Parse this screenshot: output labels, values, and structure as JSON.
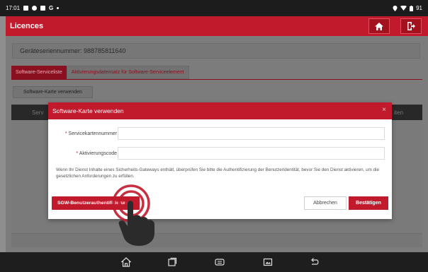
{
  "status_bar": {
    "time": "17:01",
    "battery": "91"
  },
  "app": {
    "title": "Licences",
    "accent_color": "#c01a2c"
  },
  "page": {
    "serial_label": "Geräteseriennummer: 988785811640",
    "tabs": [
      {
        "label": "Software-Serviceliste",
        "active": true
      },
      {
        "label": "Aktivierungsdatensatz für Software-Serviceelement",
        "active": false
      }
    ],
    "use_card_button": "Software-Karte verwenden",
    "table_headers": [
      "Serv",
      "iten"
    ]
  },
  "modal": {
    "title": "Software-Karte verwenden",
    "close_symbol": "×",
    "fields": [
      {
        "required_mark": "*",
        "label": "Servicekartennummer",
        "value": "",
        "placeholder": ""
      },
      {
        "required_mark": "*",
        "label": "Aktivierungscode",
        "value": "",
        "placeholder": ""
      }
    ],
    "notice": "Wenn Ihr Dienst Inhalte eines Sicherheits-Gateways enthält, überprüfen Sie bitte die Authentifizierung der Benutzeridentität, bevor Sie den Dienst aktivieren, um die gesetzlichen Anforderungen zu erfüllen.",
    "sgw_button": "SGW-Benutzerauthentifizierung",
    "cancel_button": "Abbrechen",
    "confirm_button": "Bestätigen"
  },
  "navbar": {
    "icons": [
      "home-icon",
      "recents-icon",
      "vci-icon",
      "screenshot-icon",
      "back-icon"
    ]
  }
}
